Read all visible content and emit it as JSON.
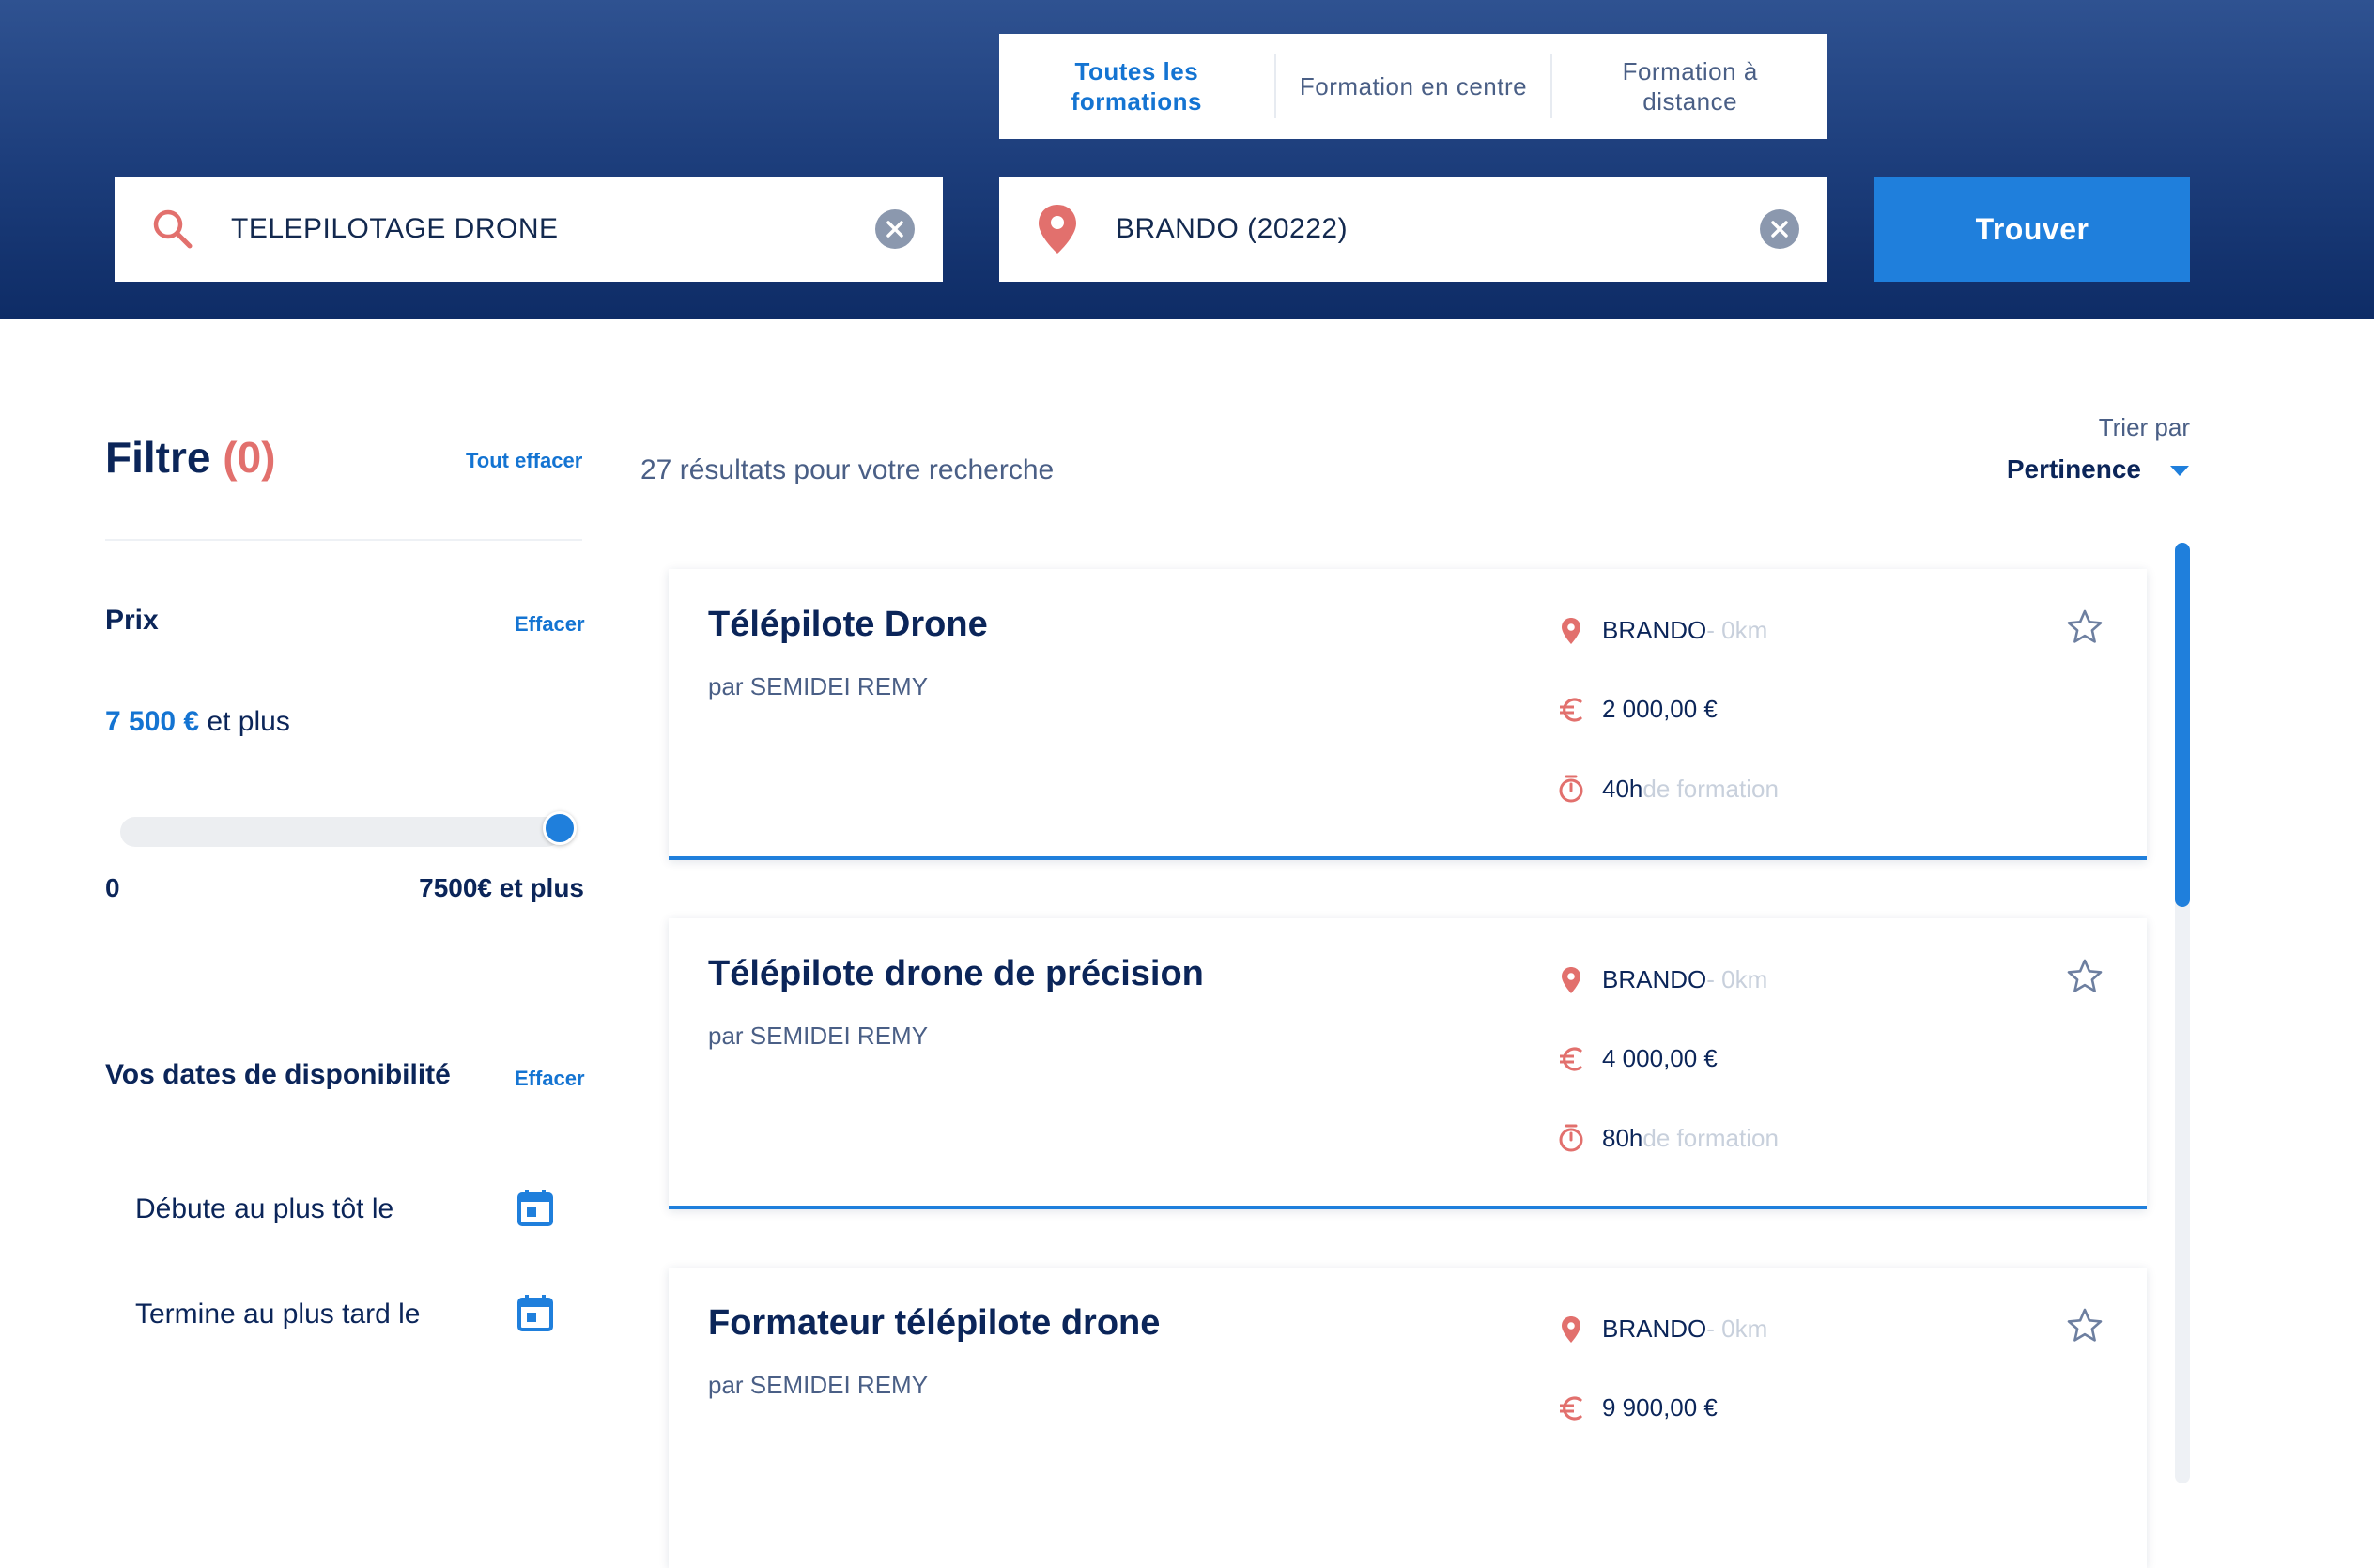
{
  "tabs": [
    {
      "label": "Toutes les formations",
      "active": true
    },
    {
      "label": "Formation en centre",
      "active": false
    },
    {
      "label": "Formation à distance",
      "active": false
    }
  ],
  "search": {
    "query_value": "TELEPILOTAGE DRONE",
    "location_value": "BRANDO (20222)",
    "find_label": "Trouver"
  },
  "filters": {
    "title": "Filtre",
    "count": "(0)",
    "clear_all": "Tout effacer",
    "price": {
      "title": "Prix",
      "clear": "Effacer",
      "value": "7 500 €",
      "suffix": " et plus",
      "slider_min_label": "0",
      "slider_max_label": "7500€ et plus",
      "slider_level": 1.0
    },
    "dates": {
      "title": "Vos dates de disponibilité",
      "clear": "Effacer",
      "start_label": "Débute au plus tôt le",
      "end_label": "Termine au plus tard le"
    }
  },
  "results": {
    "count_text": "27 résultats pour votre recherche",
    "sort_label": "Trier par",
    "sort_value": "Pertinence",
    "items": [
      {
        "title": "Télépilote Drone",
        "org": "par SEMIDEI REMY",
        "city": "BRANDO",
        "distance": " - 0km",
        "price": "2 000,00 €",
        "duration": "40h",
        "duration_suffix": " de formation"
      },
      {
        "title": "Télépilote drone de précision",
        "org": "par SEMIDEI REMY",
        "city": "BRANDO",
        "distance": " - 0km",
        "price": "4 000,00 €",
        "duration": "80h",
        "duration_suffix": " de formation"
      },
      {
        "title": "Formateur télépilote drone",
        "org": "par SEMIDEI REMY",
        "city": "BRANDO",
        "distance": " - 0km",
        "price": "9 900,00 €"
      }
    ]
  },
  "colors": {
    "header_top": "#2f5291",
    "header_bottom": "#0e2c66",
    "accent": "#1f7fdc",
    "marker": "#e2706d",
    "text_dark": "#0b2559"
  }
}
